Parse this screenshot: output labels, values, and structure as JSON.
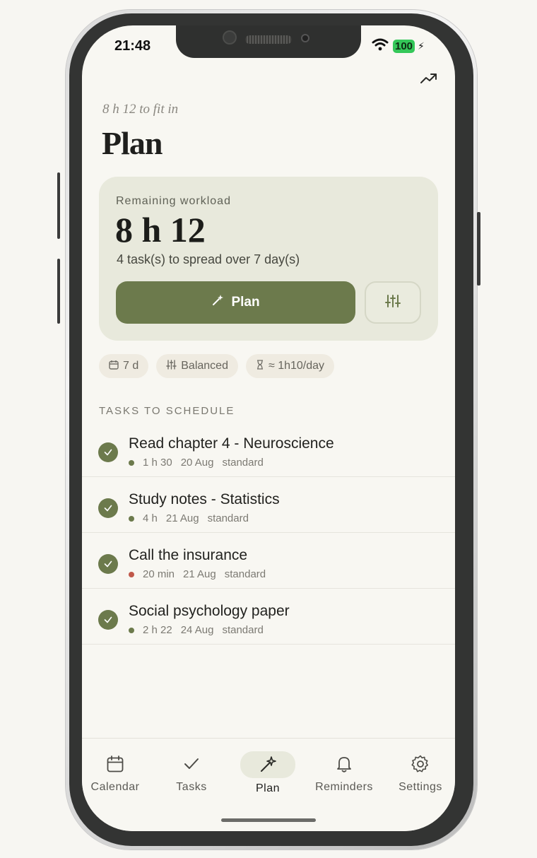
{
  "status": {
    "time": "21:48",
    "battery": "100"
  },
  "header": {
    "subtitle": "8 h 12 to fit in",
    "title": "Plan"
  },
  "summary": {
    "label": "Remaining workload",
    "value": "8 h 12",
    "description": "4 task(s) to spread over 7 day(s)",
    "plan_label": "Plan"
  },
  "chips": {
    "days": "7 d",
    "mode": "Balanced",
    "per_day": "≈ 1h10/day"
  },
  "section": {
    "title": "TASKS TO SCHEDULE"
  },
  "tasks": [
    {
      "title": "Read chapter 4 - Neuroscience",
      "duration": "1 h 30",
      "date": "20 Aug",
      "priority": "standard",
      "dot_color": "#6c7a4c"
    },
    {
      "title": "Study notes - Statistics",
      "duration": "4 h",
      "date": "21 Aug",
      "priority": "standard",
      "dot_color": "#6c7a4c"
    },
    {
      "title": "Call the insurance",
      "duration": "20 min",
      "date": "21 Aug",
      "priority": "standard",
      "dot_color": "#c0584a"
    },
    {
      "title": "Social psychology paper",
      "duration": "2 h 22",
      "date": "24 Aug",
      "priority": "standard",
      "dot_color": "#6c7a4c"
    }
  ],
  "tabs": {
    "calendar": "Calendar",
    "tasks": "Tasks",
    "plan": "Plan",
    "reminders": "Reminders",
    "settings": "Settings",
    "active": "plan"
  },
  "colors": {
    "accent": "#6c7a4c",
    "card": "#e8e9dc",
    "background": "#f8f7f2",
    "urgent_dot": "#c0584a"
  },
  "icons": [
    "trend-up-icon",
    "magic-wand-icon",
    "sliders-icon",
    "calendar-icon",
    "hourglass-icon",
    "check-icon",
    "bell-icon",
    "gear-icon",
    "wifi-icon"
  ]
}
